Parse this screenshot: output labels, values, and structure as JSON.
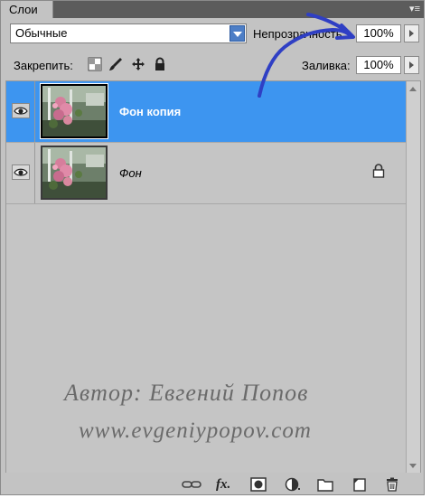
{
  "panel": {
    "tab_label": "Слои",
    "menu_glyph": "▾≡"
  },
  "blend_mode": {
    "value": "Обычные"
  },
  "opacity": {
    "label": "Непрозрачность:",
    "value": "100%"
  },
  "lock": {
    "label": "Закрепить:",
    "icons": [
      "lock-transparent-pixels-icon",
      "lock-image-pixels-icon",
      "lock-position-icon",
      "lock-all-icon"
    ]
  },
  "fill": {
    "label": "Заливка:",
    "value": "100%"
  },
  "layers": [
    {
      "name": "Фон копия",
      "selected": true,
      "visible": true,
      "locked": false
    },
    {
      "name": "Фон",
      "selected": false,
      "visible": true,
      "locked": true
    }
  ],
  "watermark": {
    "line1": "Автор: Евгений Попов",
    "line2": "www.evgeniypopov.com"
  },
  "footer_icons": [
    "link-layers-icon",
    "layer-style-fx-icon",
    "add-mask-icon",
    "adjustment-layer-icon",
    "new-group-icon",
    "new-layer-icon",
    "delete-layer-icon"
  ],
  "fx_label": "fx",
  "colors": {
    "selection": "#3d95f0",
    "panel_bg": "#c3c3c3",
    "annotation_stroke": "#2f3fc4"
  }
}
